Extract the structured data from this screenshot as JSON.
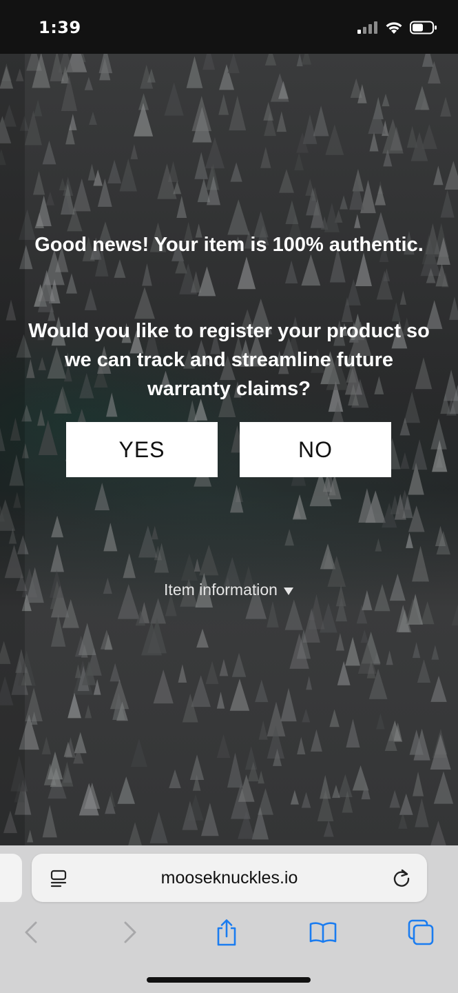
{
  "status_bar": {
    "time": "1:39",
    "icons": [
      "signal-icon",
      "wifi-icon",
      "battery-icon"
    ]
  },
  "page": {
    "headline": "Good news! Your item is 100% authentic.",
    "question": "Would you like to register your product so we can track and streamline future warranty claims?",
    "yes_label": "YES",
    "no_label": "NO",
    "item_info_label": "Item information"
  },
  "browser": {
    "url": "mooseknuckles.io",
    "toolbar": [
      "back-icon",
      "forward-icon",
      "share-icon",
      "bookmarks-icon",
      "tabs-icon"
    ]
  },
  "colors": {
    "accent": "#1a7cf0",
    "button_bg": "#ffffff",
    "toolbar_bg": "#d3d3d4"
  }
}
